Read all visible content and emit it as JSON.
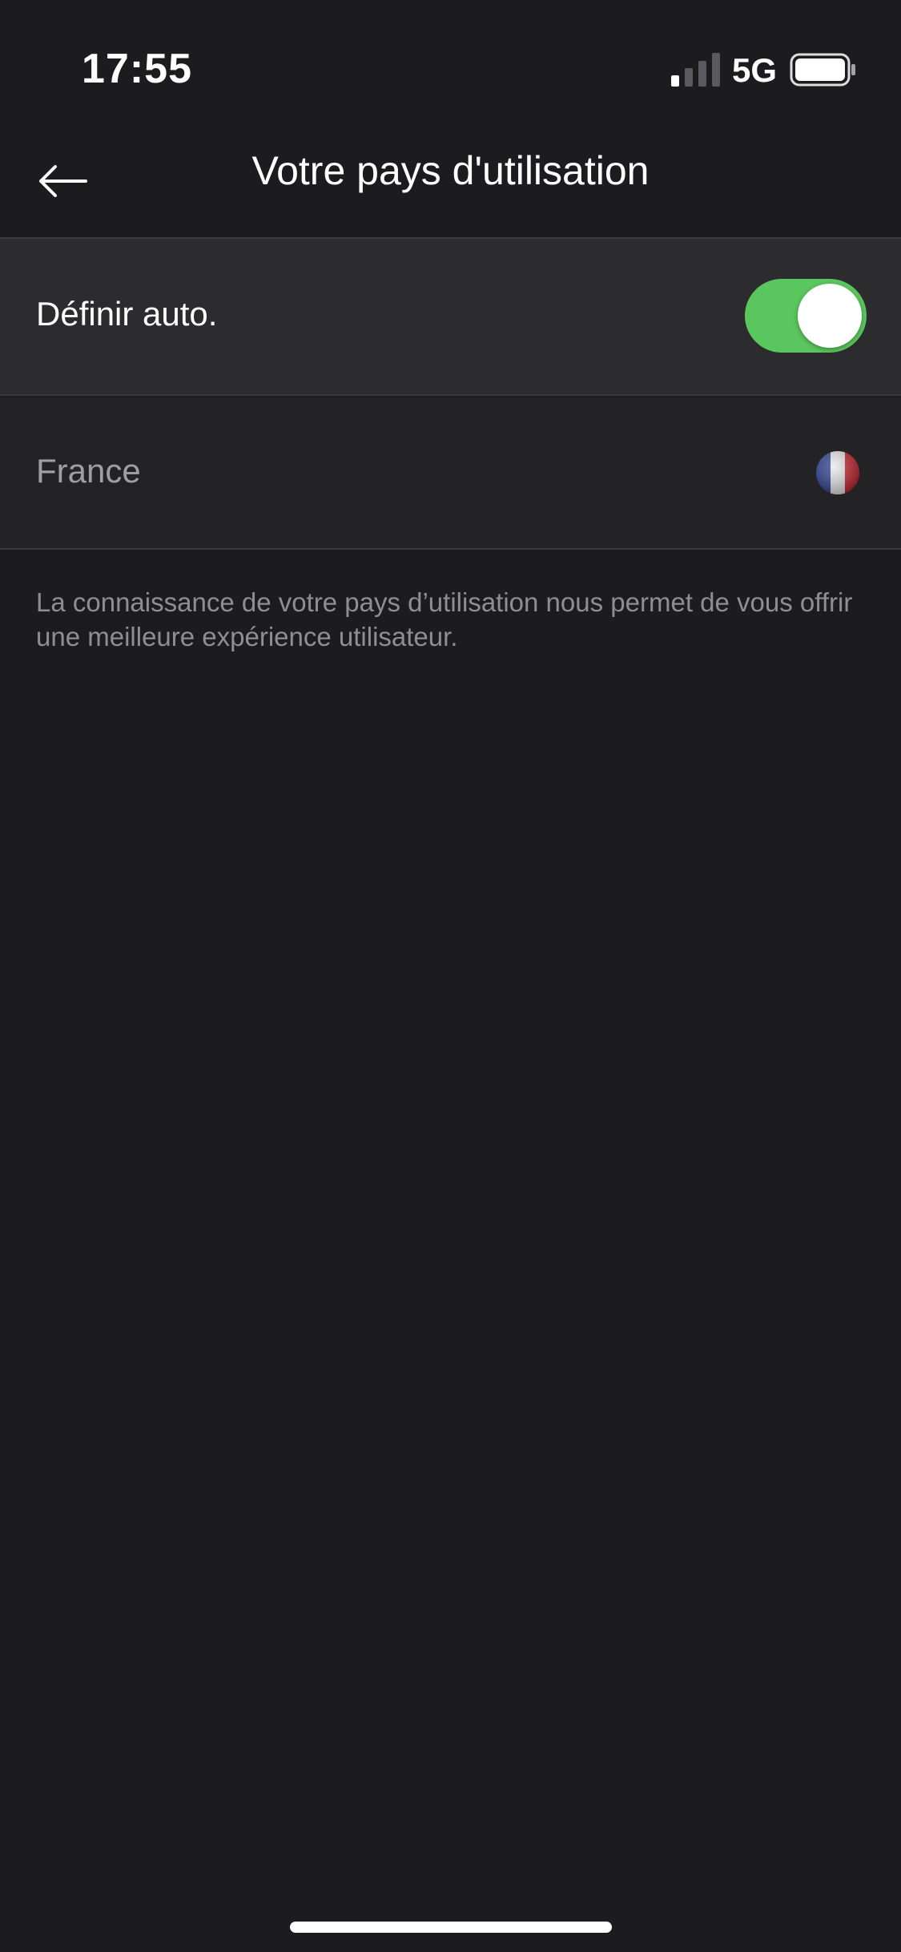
{
  "status_bar": {
    "time": "17:55",
    "network": "5G",
    "icons": {
      "signal": "cellular-signal-icon",
      "battery": "battery-icon"
    }
  },
  "header": {
    "title": "Votre pays d'utilisation",
    "back_icon": "arrow-left-icon"
  },
  "settings": {
    "auto": {
      "label": "Définir auto.",
      "toggle_on": true,
      "toggle_color": "#5ac65e"
    },
    "country": {
      "label": "France",
      "flag_icon": "france-flag-icon"
    }
  },
  "description": "La connaissance de votre pays d’utilisation nous permet de vous offrir une meilleure expérience utilisateur.",
  "colors": {
    "background": "#1c1c1e",
    "row_background": "#2c2c2e",
    "secondary_text": "#8e8e93"
  }
}
